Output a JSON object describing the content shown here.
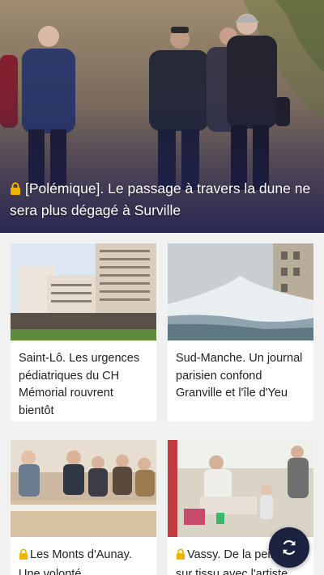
{
  "featured": {
    "title": "[Polémique]. Le passage à travers la dune ne sera plus dégagé à Surville",
    "premium": true
  },
  "articles": [
    {
      "title": "Saint-Lô. Les urgences pédiatriques du CH Mémorial rouvrent bientôt",
      "premium": false
    },
    {
      "title": "Sud-Manche. Un journal parisien confond Granville et l'île d'Yeu",
      "premium": false
    },
    {
      "title": "Les Monts d'Aunay. Une volonté",
      "premium": true
    },
    {
      "title": "Vassy. De la peinture sur tissu avec l'artiste",
      "premium": true
    }
  ],
  "fab": {
    "icon": "refresh-icon"
  },
  "colors": {
    "fab": "#1b2240",
    "lock": "#f0b400",
    "hero_overlay": "#1e1f55"
  }
}
